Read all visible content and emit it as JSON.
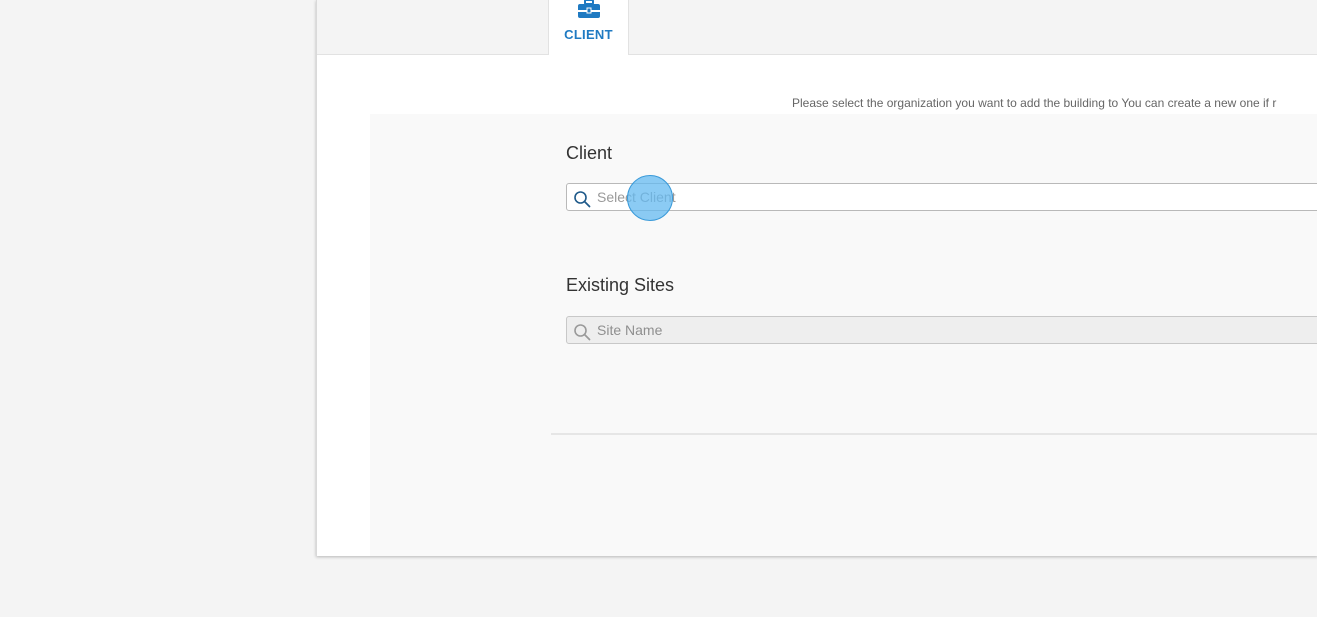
{
  "tabs": [
    {
      "label": "CLIENT",
      "icon": "briefcase-icon",
      "active": true
    }
  ],
  "instructions": "Please select the organization you want to add the building to You can create a new one if r",
  "client": {
    "label": "Client",
    "placeholder": "Select Client",
    "value": ""
  },
  "existing_sites": {
    "label": "Existing Sites",
    "placeholder": "Site Name",
    "value": ""
  },
  "colors": {
    "accent": "#1f7ac2",
    "click_indicator": "#64b9f0"
  }
}
